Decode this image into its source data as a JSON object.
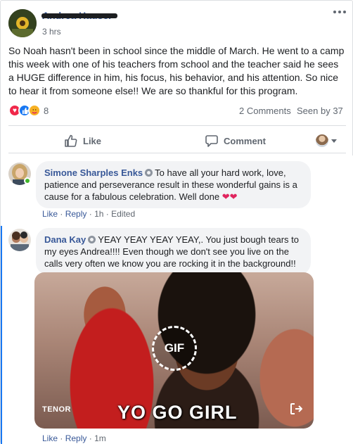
{
  "post": {
    "author_name": "Andrea Hauser",
    "timestamp": "3 hrs",
    "text": "So Noah hasn't been in school since the middle of March. He went to a camp this week with one of his teachers from school and the teacher said he sees a HUGE difference in him, his focus, his behavior, and his attention. So nice to hear it from someone else!! We are so thankful for this program.",
    "reactions": {
      "icons": [
        "love-reaction",
        "like-reaction",
        "care-reaction"
      ],
      "count": "8"
    },
    "comments_count": "2 Comments",
    "seen_by": "Seen by 37"
  },
  "actions": {
    "like_label": "Like",
    "comment_label": "Comment"
  },
  "comments": [
    {
      "author": "Simone Sharples Enks",
      "text": "To have all your hard work, love, patience and perseverance result in these wonderful gains is a cause for a fabulous celebration. Well done",
      "emoji": "❤❤",
      "like": "Like",
      "reply": "Reply",
      "time": "1h",
      "edited": "Edited"
    },
    {
      "author": "Dana Kay",
      "text": "YEAY YEAY YEAY YEAY,. You just bough tears to my eyes Andrea!!!! Even though we don't see you live on the calls very often we know you are rocking it in the background!!",
      "gif": {
        "badge": "GIF",
        "provider": "TENOR",
        "caption": "YO GO GIRL"
      },
      "like": "Like",
      "reply": "Reply",
      "time": "1m"
    }
  ],
  "colors": {
    "link": "#385898",
    "meta": "#606770",
    "online": "#42b72a",
    "thread_accent": "#1877f2"
  }
}
